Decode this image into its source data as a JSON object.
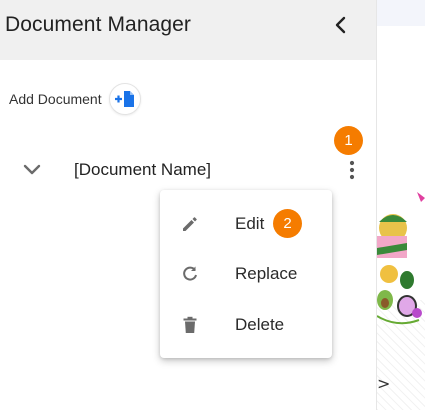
{
  "panel": {
    "title": "Document Manager",
    "add_document_label": "Add Document"
  },
  "document": {
    "name": "[Document Name]"
  },
  "context_menu": {
    "items": [
      {
        "label": "Edit",
        "icon": "pencil-icon"
      },
      {
        "label": "Replace",
        "icon": "refresh-icon"
      },
      {
        "label": "Delete",
        "icon": "trash-icon"
      }
    ]
  },
  "badges": {
    "step_1": "1",
    "step_2": "2"
  },
  "colors": {
    "accent": "#1a73e8",
    "badge": "#f57c00",
    "header_bg": "#f0f0f0",
    "icon_gray": "#6b6b6b"
  },
  "right_area": {
    "chevron": ">"
  }
}
